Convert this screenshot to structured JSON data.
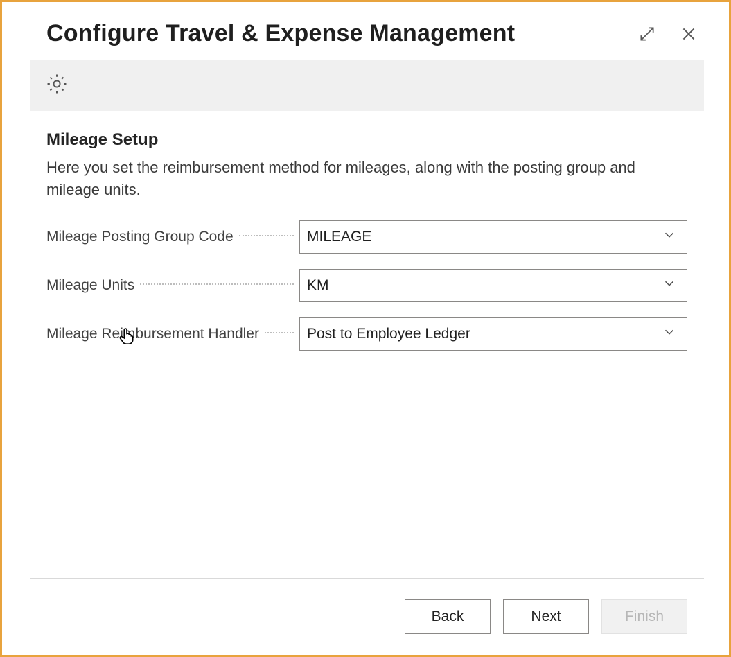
{
  "header": {
    "title": "Configure Travel & Expense Management"
  },
  "toolbar": {
    "settings_icon_name": "gear-icon"
  },
  "section": {
    "title": "Mileage Setup",
    "description": "Here you set the reimbursement method for mileages, along with the posting group and mileage units."
  },
  "fields": {
    "posting_group": {
      "label": "Mileage Posting Group Code",
      "value": "MILEAGE"
    },
    "units": {
      "label": "Mileage Units",
      "value": "KM"
    },
    "handler": {
      "label": "Mileage Reimbursement Handler",
      "value": "Post to Employee Ledger"
    }
  },
  "footer": {
    "back": "Back",
    "next": "Next",
    "finish": "Finish"
  }
}
